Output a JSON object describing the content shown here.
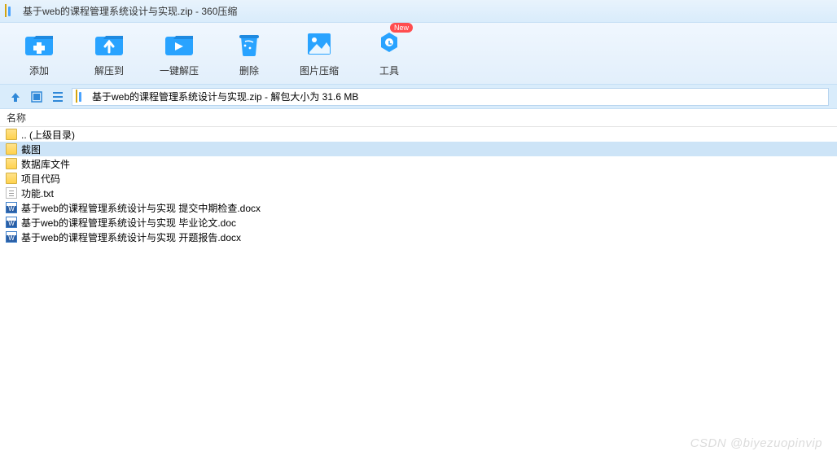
{
  "title": "基于web的课程管理系统设计与实现.zip - 360压缩",
  "toolbar": {
    "add": "添加",
    "extract_to": "解压到",
    "one_click_extract": "一键解压",
    "delete": "删除",
    "image_compress": "图片压缩",
    "tools": "工具",
    "tools_badge": "New"
  },
  "pathbar": {
    "text": "基于web的课程管理系统设计与实现.zip - 解包大小为 31.6 MB"
  },
  "columns": {
    "name": "名称"
  },
  "files": [
    {
      "name": ".. (上级目录)",
      "type": "folder"
    },
    {
      "name": "截图",
      "type": "folder",
      "selected": true
    },
    {
      "name": "数据库文件",
      "type": "folder"
    },
    {
      "name": "项目代码",
      "type": "folder"
    },
    {
      "name": "功能.txt",
      "type": "txt"
    },
    {
      "name": "基于web的课程管理系统设计与实现  提交中期检查.docx",
      "type": "doc"
    },
    {
      "name": "基于web的课程管理系统设计与实现 毕业论文.doc",
      "type": "doc"
    },
    {
      "name": "基于web的课程管理系统设计与实现 开题报告.docx",
      "type": "doc"
    }
  ],
  "watermark": "CSDN @biyezuopinvip"
}
